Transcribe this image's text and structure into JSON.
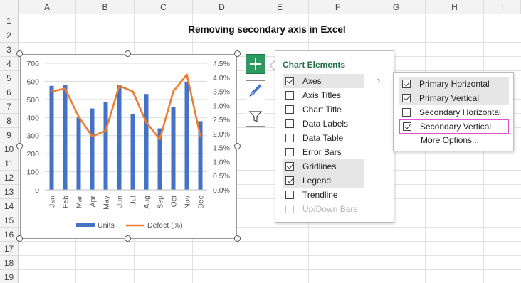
{
  "sheet": {
    "columns": [
      "A",
      "B",
      "C",
      "D",
      "E",
      "F",
      "G",
      "H",
      "I"
    ],
    "rows": [
      "1",
      "2",
      "3",
      "4",
      "5",
      "6",
      "7",
      "8",
      "9",
      "10",
      "11",
      "12",
      "13",
      "14",
      "15",
      "16",
      "17",
      "18",
      "19"
    ],
    "title": "Removing secondary axis in Excel"
  },
  "side_buttons": {
    "elements": "plus-icon",
    "styles": "paintbrush-icon",
    "filters": "funnel-icon"
  },
  "flyout": {
    "title": "Chart Elements",
    "items": [
      {
        "label": "Axes",
        "checked": true,
        "highlighted": true,
        "disabled": false
      },
      {
        "label": "Axis Titles",
        "checked": false,
        "highlighted": false,
        "disabled": false
      },
      {
        "label": "Chart Title",
        "checked": false,
        "highlighted": false,
        "disabled": false
      },
      {
        "label": "Data Labels",
        "checked": false,
        "highlighted": false,
        "disabled": false
      },
      {
        "label": "Data Table",
        "checked": false,
        "highlighted": false,
        "disabled": false
      },
      {
        "label": "Error Bars",
        "checked": false,
        "highlighted": false,
        "disabled": false
      },
      {
        "label": "Gridlines",
        "checked": true,
        "highlighted": true,
        "disabled": false
      },
      {
        "label": "Legend",
        "checked": true,
        "highlighted": true,
        "disabled": false
      },
      {
        "label": "Trendline",
        "checked": false,
        "highlighted": false,
        "disabled": false
      },
      {
        "label": "Up/Down Bars",
        "checked": false,
        "highlighted": false,
        "disabled": true
      }
    ],
    "chevron": "›"
  },
  "submenu": {
    "items": [
      {
        "label": "Primary Horizontal",
        "checked": true,
        "highlighted": true
      },
      {
        "label": "Primary Vertical",
        "checked": true,
        "highlighted": true
      },
      {
        "label": "Secondary Horizontal",
        "checked": false,
        "highlighted": false
      },
      {
        "label": "Secondary Vertical",
        "checked": true,
        "highlighted": false
      }
    ],
    "more_options": "More Options..."
  },
  "colors": {
    "bars": "#4472c4",
    "line": "#ed7d31",
    "accent_green": "#217346",
    "highlight_box": "#e64fd6"
  },
  "chart_data": {
    "type": "bar",
    "categories": [
      "Jan",
      "Feb",
      "Mar",
      "Apr",
      "May",
      "Jun",
      "Jul",
      "Aug",
      "Sep",
      "Oct",
      "Nov",
      "Dec"
    ],
    "series": [
      {
        "name": "Units",
        "type": "bar",
        "axis": "primary",
        "values": [
          575,
          580,
          400,
          450,
          485,
          580,
          420,
          530,
          340,
          460,
          595,
          380
        ]
      },
      {
        "name": "Defect (%)",
        "type": "line",
        "axis": "secondary",
        "values": [
          3.5,
          3.6,
          2.6,
          1.9,
          2.1,
          3.7,
          3.5,
          2.4,
          1.8,
          3.5,
          4.1,
          1.9
        ]
      }
    ],
    "y_ticks": [
      "0",
      "100",
      "200",
      "300",
      "400",
      "500",
      "600",
      "700"
    ],
    "y2_ticks": [
      "0.0%",
      "0.5%",
      "1.0%",
      "1.5%",
      "2.0%",
      "2.5%",
      "3.0%",
      "3.5%",
      "4.0%",
      "4.5%"
    ],
    "ylim": [
      0,
      700
    ],
    "y2lim": [
      0,
      4.5
    ],
    "grid": true,
    "legend": "bottom"
  }
}
